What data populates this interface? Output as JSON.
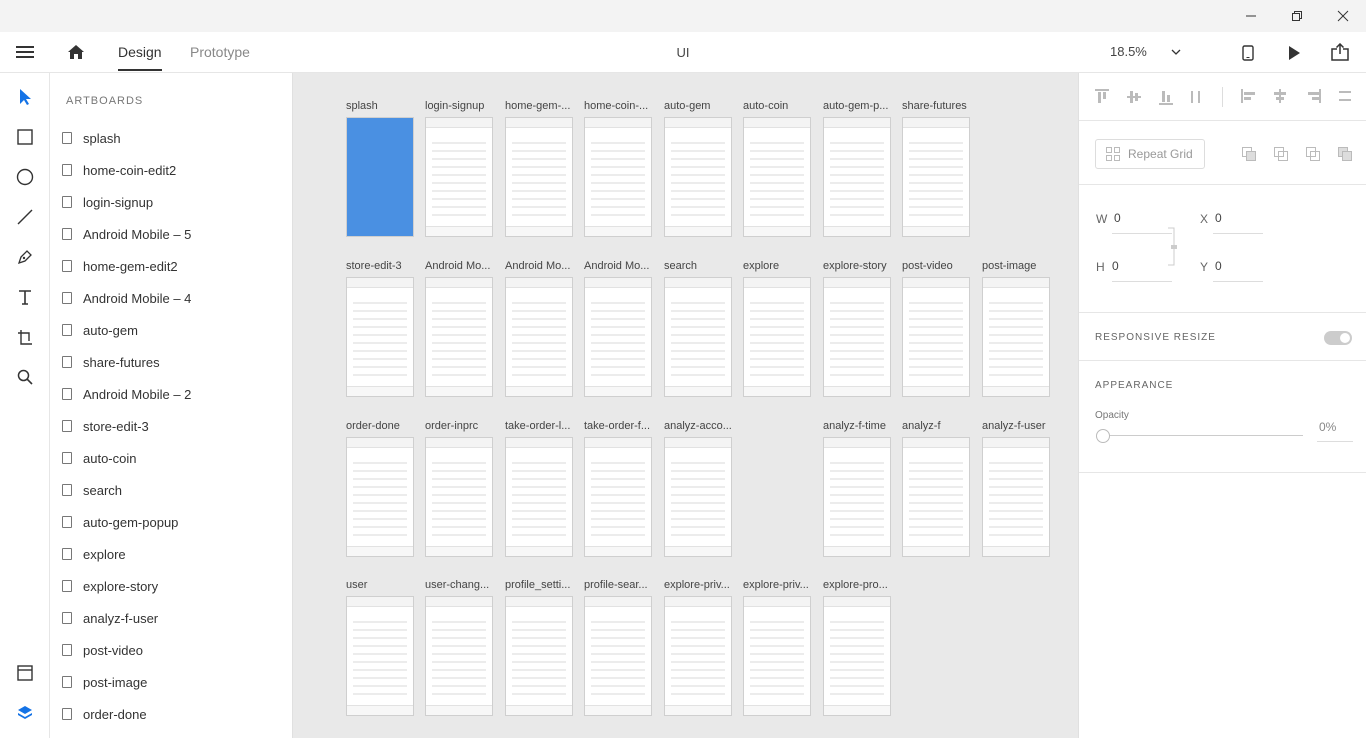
{
  "window": {
    "minimize_icon": "minimize-icon",
    "maximize_icon": "restore-icon",
    "close_icon": "close-icon"
  },
  "toolbar": {
    "tabs": [
      "Design",
      "Prototype"
    ],
    "active_tab": "Design",
    "document_title": "UI",
    "zoom": "18.5%"
  },
  "layers": {
    "header": "ARTBOARDS",
    "items": [
      "splash",
      "home-coin-edit2",
      "login-signup",
      "Android Mobile – 5",
      "home-gem-edit2",
      "Android Mobile – 4",
      "auto-gem",
      "share-futures",
      "Android Mobile – 2",
      "store-edit-3",
      "auto-coin",
      "search",
      "auto-gem-popup",
      "explore",
      "explore-story",
      "analyz-f-user",
      "post-video",
      "post-image",
      "order-done"
    ]
  },
  "canvas": {
    "rows": [
      [
        "splash",
        "login-signup",
        "home-gem-...",
        "home-coin-...",
        "auto-gem",
        "auto-coin",
        "auto-gem-p...",
        "share-futures"
      ],
      [
        "store-edit-3",
        "Android Mo...",
        "Android Mo...",
        "Android Mo...",
        "search",
        "explore",
        "explore-story",
        "post-video",
        "post-image"
      ],
      [
        "order-done",
        "order-inprc",
        "take-order-l...",
        "take-order-f...",
        "analyz-acco...",
        "",
        "analyz-f-time",
        "analyz-f",
        "analyz-f-user"
      ],
      [
        "user",
        "user-chang...",
        "profile_setti...",
        "profile-sear...",
        "explore-priv...",
        "explore-priv...",
        "explore-pro..."
      ]
    ]
  },
  "properties": {
    "repeat_grid": "Repeat Grid",
    "w_label": "W",
    "w_value": "0",
    "h_label": "H",
    "h_value": "0",
    "x_label": "X",
    "x_value": "0",
    "y_label": "Y",
    "y_value": "0",
    "responsive_resize": "RESPONSIVE RESIZE",
    "appearance": "APPEARANCE",
    "opacity_label": "Opacity",
    "opacity_value": "0%"
  },
  "colors": {
    "accent": "#1473e6",
    "splash_blue": "#4a90e2",
    "canvas_bg": "#e9e9e9"
  }
}
